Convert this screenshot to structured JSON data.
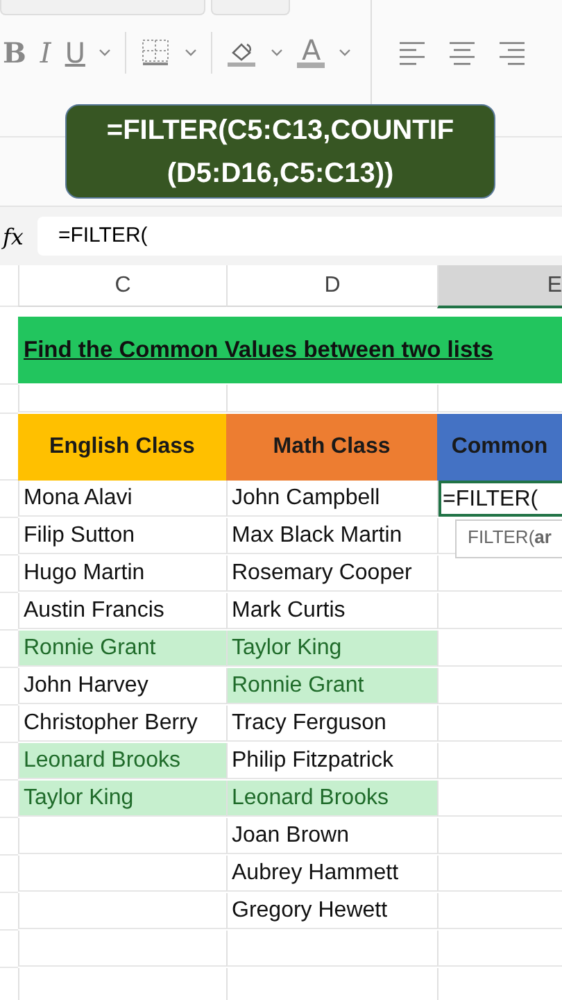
{
  "ribbon": {
    "toolbar": [
      {
        "kind": "bold",
        "label": "B"
      },
      {
        "kind": "italic",
        "label": "I"
      },
      {
        "kind": "underline",
        "label": "U"
      },
      {
        "kind": "caret"
      },
      {
        "kind": "separator"
      },
      {
        "kind": "borders"
      },
      {
        "kind": "caret"
      },
      {
        "kind": "separator"
      },
      {
        "kind": "fill"
      },
      {
        "kind": "caret"
      },
      {
        "kind": "font_color",
        "label": "A"
      },
      {
        "kind": "caret"
      }
    ],
    "alignment": [
      {
        "kind": "left"
      },
      {
        "kind": "center"
      },
      {
        "kind": "right"
      }
    ]
  },
  "caption": {
    "lines": [
      "=FILTER(C5:C13,COUNTIF",
      "(D5:D16,C5:C13))"
    ]
  },
  "formula_bar": {
    "function_label": "fx",
    "value": "=FILTER("
  },
  "columns": [
    {
      "label": "C",
      "selected": false
    },
    {
      "label": "D",
      "selected": false
    },
    {
      "label": "E",
      "selected": true
    }
  ],
  "title": "Find the Common Values between two lists",
  "headers": [
    {
      "label": "English Class",
      "color": "#ffc000"
    },
    {
      "label": "Math Class",
      "color": "#ed7d31"
    },
    {
      "label": "Common",
      "color": "#4472c4"
    }
  ],
  "rows": [
    {
      "english": {
        "text": "Mona Alavi",
        "highlighted": false
      },
      "math": {
        "text": "John Campbell",
        "highlighted": false
      },
      "common": {
        "text": "=FILTER(",
        "active": true
      }
    },
    {
      "english": {
        "text": "Filip Sutton",
        "highlighted": false
      },
      "math": {
        "text": "Max Black Martin",
        "highlighted": false
      }
    },
    {
      "english": {
        "text": "Hugo Martin",
        "highlighted": false
      },
      "math": {
        "text": "Rosemary Cooper",
        "highlighted": false
      }
    },
    {
      "english": {
        "text": "Austin Francis",
        "highlighted": false
      },
      "math": {
        "text": "Mark Curtis",
        "highlighted": false
      }
    },
    {
      "english": {
        "text": "Ronnie Grant",
        "highlighted": true
      },
      "math": {
        "text": "Taylor King",
        "highlighted": true
      }
    },
    {
      "english": {
        "text": "John Harvey",
        "highlighted": false
      },
      "math": {
        "text": "Ronnie Grant",
        "highlighted": true
      }
    },
    {
      "english": {
        "text": "Christopher Berry",
        "highlighted": false
      },
      "math": {
        "text": "Tracy Ferguson",
        "highlighted": false
      }
    },
    {
      "english": {
        "text": "Leonard Brooks",
        "highlighted": true
      },
      "math": {
        "text": "Philip Fitzpatrick",
        "highlighted": false
      }
    },
    {
      "english": {
        "text": "Taylor King",
        "highlighted": true
      },
      "math": {
        "text": "Leonard Brooks",
        "highlighted": true
      }
    },
    {
      "math": {
        "text": "Joan Brown",
        "highlighted": false
      }
    },
    {
      "math": {
        "text": "Aubrey Hammett",
        "highlighted": false
      }
    },
    {
      "math": {
        "text": "Gregory Hewett",
        "highlighted": false
      }
    },
    {},
    {}
  ],
  "tooltip": {
    "text": "FILTER(**ar**"
  }
}
